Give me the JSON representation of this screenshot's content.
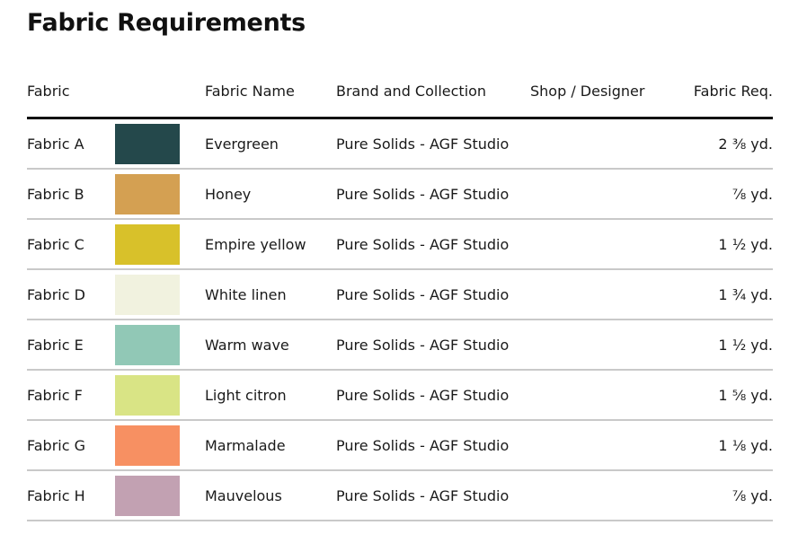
{
  "page": {
    "title": "Fabric Requirements"
  },
  "table": {
    "headers": {
      "fabric": "Fabric",
      "swatch": "",
      "fabric_name": "Fabric Name",
      "brand_collection": "Brand and Collection",
      "shop_designer": "Shop / Designer",
      "fabric_req": "Fabric Req."
    },
    "rows": [
      {
        "fabric": "Fabric A",
        "color": "#24484b",
        "name": "Evergreen",
        "brand": "Pure Solids - AGF Studio",
        "shop": "",
        "req": "2 ⅜ yd."
      },
      {
        "fabric": "Fabric B",
        "color": "#d4a052",
        "name": "Honey",
        "brand": "Pure Solids - AGF Studio",
        "shop": "",
        "req": "⅞ yd."
      },
      {
        "fabric": "Fabric C",
        "color": "#d8c12a",
        "name": "Empire yellow",
        "brand": "Pure Solids - AGF Studio",
        "shop": "",
        "req": "1 ½ yd."
      },
      {
        "fabric": "Fabric D",
        "color": "#f1f2df",
        "name": "White linen",
        "brand": "Pure Solids - AGF Studio",
        "shop": "",
        "req": "1 ¾ yd."
      },
      {
        "fabric": "Fabric E",
        "color": "#91c8b6",
        "name": "Warm wave",
        "brand": "Pure Solids - AGF Studio",
        "shop": "",
        "req": "1 ½ yd."
      },
      {
        "fabric": "Fabric F",
        "color": "#d9e485",
        "name": "Light citron",
        "brand": "Pure Solids - AGF Studio",
        "shop": "",
        "req": "1 ⅝ yd."
      },
      {
        "fabric": "Fabric G",
        "color": "#f79062",
        "name": "Marmalade",
        "brand": "Pure Solids - AGF Studio",
        "shop": "",
        "req": "1 ⅛ yd."
      },
      {
        "fabric": "Fabric H",
        "color": "#c2a1b2",
        "name": "Mauvelous",
        "brand": "Pure Solids - AGF Studio",
        "shop": "",
        "req": "⅞ yd."
      }
    ]
  }
}
